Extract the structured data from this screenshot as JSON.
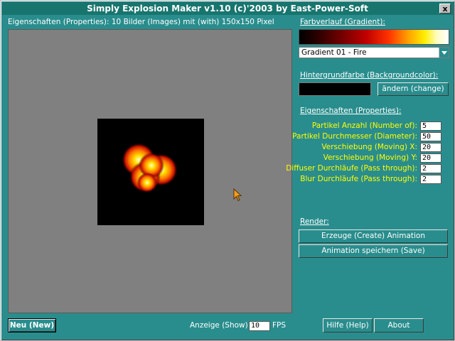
{
  "window": {
    "title": "Simply Explosion Maker v1.10 (c)'2003 by East-Power-Soft",
    "close_glyph": "x"
  },
  "preview": {
    "header": "Eigenschaften (Properties): 10 Bilder (Images) mit (with) 150x150 Pixel"
  },
  "gradient": {
    "label": "Farbverlauf (Gradient):",
    "selected": "Gradient 01 - Fire"
  },
  "background": {
    "label": "Hintergrundfarbe (Backgroundcolor):",
    "color": "#000000",
    "change_button": "ändern (change)"
  },
  "properties": {
    "label": "Eigenschaften (Properties):",
    "fields": [
      {
        "label": "Partikel Anzahl (Number of):",
        "value": "5"
      },
      {
        "label": "Partikel Durchmesser (Diameter):",
        "value": "50"
      },
      {
        "label": "Verschiebung (Moving) X:",
        "value": "20"
      },
      {
        "label": "Verschiebung (Moving) Y:",
        "value": "20"
      },
      {
        "label": "Diffuser Durchläufe (Pass through):",
        "value": "2"
      },
      {
        "label": "Blur Durchläufe (Pass through):",
        "value": "2"
      }
    ]
  },
  "render": {
    "label": "Render:",
    "create_button": "Erzeuge (Create) Animation",
    "save_button": "Animation speichern (Save)"
  },
  "footer": {
    "new_button": "Neu (New)",
    "show_label": "Anzeige (Show):",
    "fps_value": "10",
    "fps_unit": "FPS",
    "help_button": "Hilfe (Help)",
    "about_button": "About"
  },
  "colors": {
    "window_bg": "#2a8d8d",
    "titlebar_bg": "#18756e",
    "label_yellow": "#ffff00",
    "preview_gray": "#808080"
  }
}
